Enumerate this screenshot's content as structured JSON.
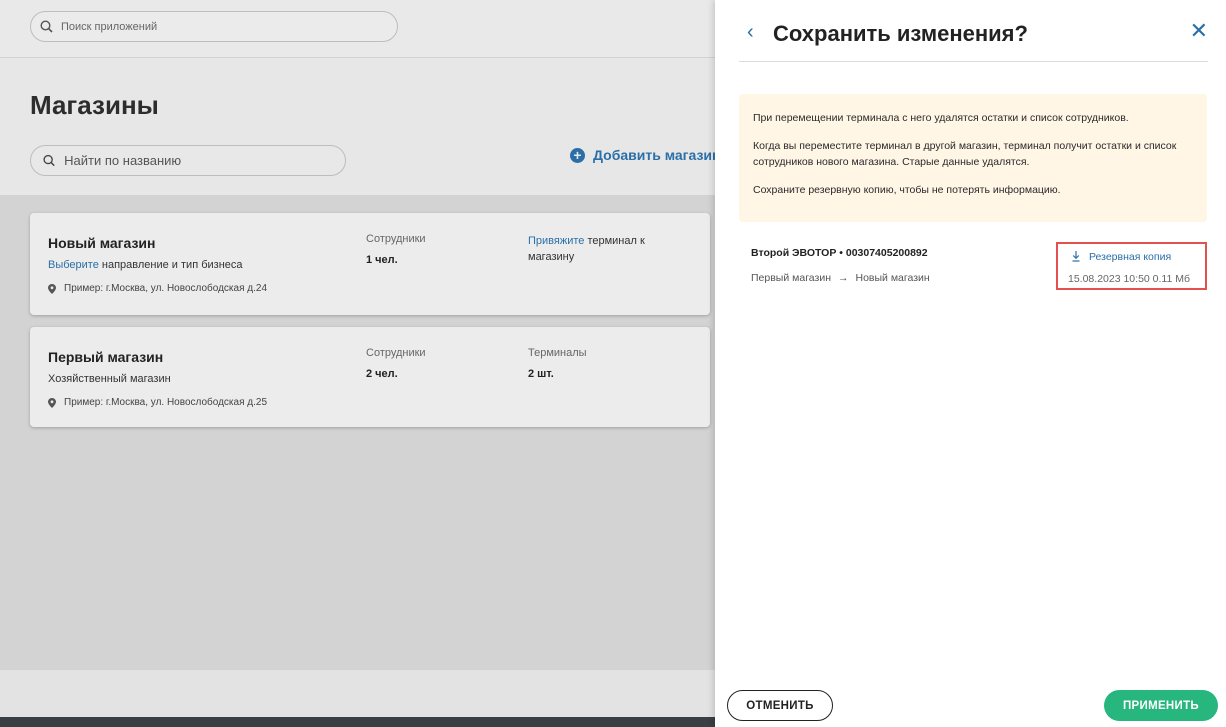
{
  "app": {
    "search_placeholder": "Поиск приложений",
    "page_title": "Магазины",
    "store_search_placeholder": "Найти по названию",
    "add_store_label": "Добавить магазин"
  },
  "stores": [
    {
      "name": "Новый магазин",
      "sub_link": "Выберите",
      "sub_text": " направление и тип бизнеса",
      "address": "Пример: г.Москва, ул. Новослободская д.24",
      "employees_label": "Сотрудники",
      "employees_value": "1 чел.",
      "terminal_link": "Привяжите",
      "terminal_text": " терминал к магазину"
    },
    {
      "name": "Первый магазин",
      "sub_text": "Хозяйственный магазин",
      "address": "Пример: г.Москва, ул. Новослободская д.25",
      "employees_label": "Сотрудники",
      "employees_value": "2 чел.",
      "terminals_label": "Терминалы",
      "terminals_value": "2 шт."
    }
  ],
  "panel": {
    "title": "Сохранить изменения?",
    "warning": {
      "p1": "При перемещении терминала с него удалятся остатки и список сотрудников.",
      "p2": "Когда вы переместите терминал в другой магазин, терминал получит остатки и список сотрудников нового магазина. Старые данные удалятся.",
      "p3": "Сохраните резервную копию, чтобы не потерять информацию."
    },
    "terminal": {
      "name": "Второй ЭВОТОР • 00307405200892",
      "from": "Первый магазин",
      "arrow": "→",
      "to": "Новый магазин"
    },
    "backup": {
      "label": "Резервная копия",
      "meta": "15.08.2023 10:50 0.11 Мб"
    },
    "cancel_label": "ОТМЕНИТЬ",
    "apply_label": "ПРИМЕНИТЬ"
  },
  "colors": {
    "accent": "#2a6fa8",
    "apply": "#27b67d",
    "warning_bg": "#fff6e5",
    "highlight": "#e35050"
  }
}
